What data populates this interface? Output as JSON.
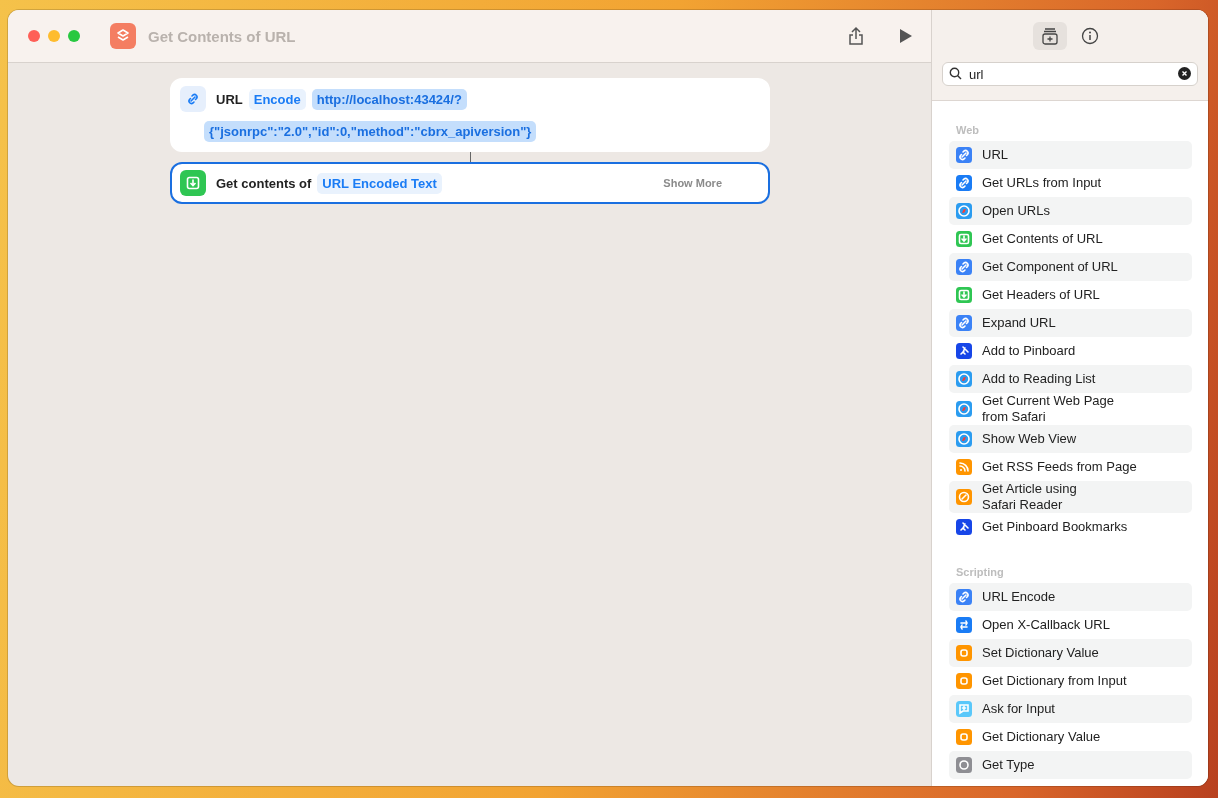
{
  "window": {
    "title": "Get Contents of URL"
  },
  "actions": [
    {
      "kind": "url",
      "label": "URL",
      "token": "Encode",
      "value_lines": [
        "http://localhost:43424/?",
        "{\"jsonrpc\":\"2.0\",\"id\":0,\"method\":\"cbrx_apiversion\"}"
      ],
      "selected": false
    },
    {
      "kind": "download",
      "label": "Get contents of",
      "variable": "URL Encoded Text",
      "more": "Show More",
      "selected": true
    }
  ],
  "search": {
    "value": "url"
  },
  "sections": [
    {
      "title": "Web",
      "items": [
        {
          "label": "URL",
          "kind": "link",
          "color": "#3b82f6"
        },
        {
          "label": "Get URLs from Input",
          "kind": "link",
          "color": "#1a7cf5"
        },
        {
          "label": "Open URLs",
          "kind": "safari",
          "color": "#2b9cf0"
        },
        {
          "label": "Get Contents of URL",
          "kind": "download",
          "color": "#2fc653"
        },
        {
          "label": "Get Component of URL",
          "kind": "link",
          "color": "#3b82f6"
        },
        {
          "label": "Get Headers of URL",
          "kind": "download",
          "color": "#2fc653"
        },
        {
          "label": "Expand URL",
          "kind": "link",
          "color": "#3b82f6"
        },
        {
          "label": "Add to Pinboard",
          "kind": "pin",
          "color": "#1746e8"
        },
        {
          "label": "Add to Reading List",
          "kind": "safari",
          "color": "#2b9cf0"
        },
        {
          "label": "Get Current Web Page\nfrom Safari",
          "kind": "safari",
          "color": "#2b9cf0"
        },
        {
          "label": "Show Web View",
          "kind": "safari",
          "color": "#2b9cf0"
        },
        {
          "label": "Get RSS Feeds from Page",
          "kind": "rss",
          "color": "#ff9500"
        },
        {
          "label": "Get Article using\nSafari Reader",
          "kind": "compass",
          "color": "#ff9500"
        },
        {
          "label": "Get Pinboard Bookmarks",
          "kind": "pin",
          "color": "#1746e8"
        }
      ]
    },
    {
      "title": "Scripting",
      "items": [
        {
          "label": "URL Encode",
          "kind": "link",
          "color": "#3b82f6"
        },
        {
          "label": "Open X-Callback URL",
          "kind": "callback",
          "color": "#1a7cf5"
        },
        {
          "label": "Set Dictionary Value",
          "kind": "dict",
          "color": "#ff9500"
        },
        {
          "label": "Get Dictionary from Input",
          "kind": "dict",
          "color": "#ff9500"
        },
        {
          "label": "Ask for Input",
          "kind": "ask",
          "color": "#5ac8fa"
        },
        {
          "label": "Get Dictionary Value",
          "kind": "dict",
          "color": "#ff9500"
        },
        {
          "label": "Get Type",
          "kind": "type",
          "color": "#8e8e93"
        }
      ]
    }
  ]
}
